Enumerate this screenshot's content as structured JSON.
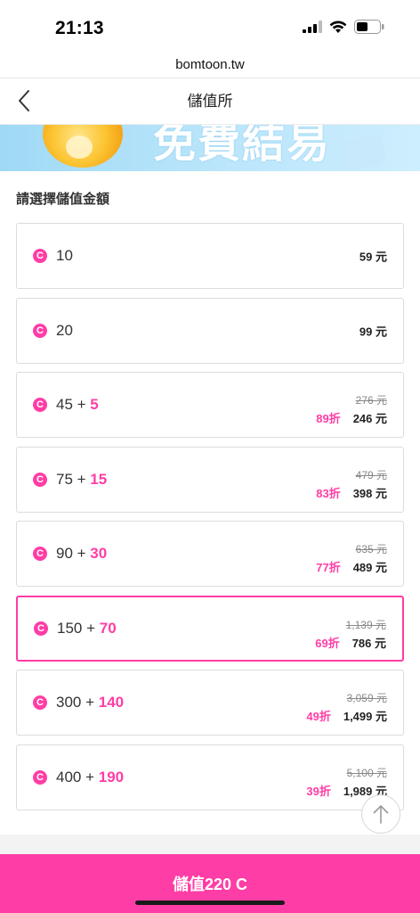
{
  "status": {
    "time": "21:13"
  },
  "browser": {
    "url": "bomtoon.tw"
  },
  "nav": {
    "title": "儲值所"
  },
  "banner": {
    "text": "免費結易"
  },
  "section_title": "請選擇儲值金額",
  "coin_symbol": "C",
  "options": [
    {
      "base": "10",
      "bonus": "",
      "original_price": "",
      "discount": "",
      "price": "59 元",
      "selected": false
    },
    {
      "base": "20",
      "bonus": "",
      "original_price": "",
      "discount": "",
      "price": "99 元",
      "selected": false
    },
    {
      "base": "45 + ",
      "bonus": "5",
      "original_price": "276 元",
      "discount": "89折",
      "price": "246 元",
      "selected": false
    },
    {
      "base": "75 + ",
      "bonus": "15",
      "original_price": "479 元",
      "discount": "83折",
      "price": "398 元",
      "selected": false
    },
    {
      "base": "90 + ",
      "bonus": "30",
      "original_price": "635 元",
      "discount": "77折",
      "price": "489 元",
      "selected": false
    },
    {
      "base": "150 + ",
      "bonus": "70",
      "original_price": "1,139 元",
      "discount": "69折",
      "price": "786 元",
      "selected": true
    },
    {
      "base": "300 + ",
      "bonus": "140",
      "original_price": "3,059 元",
      "discount": "49折",
      "price": "1,499 元",
      "selected": false
    },
    {
      "base": "400 + ",
      "bonus": "190",
      "original_price": "5,100 元",
      "discount": "39折",
      "price": "1,989 元",
      "selected": false
    }
  ],
  "charge_button": {
    "label": "儲值220 C"
  },
  "colors": {
    "accent": "#ff3da6",
    "border": "#dcdcdc",
    "text": "#222222"
  },
  "icons": [
    "signal-icon",
    "wifi-icon",
    "battery-icon",
    "back-arrow-icon",
    "coin-icon",
    "scroll-top-arrow-icon"
  ]
}
